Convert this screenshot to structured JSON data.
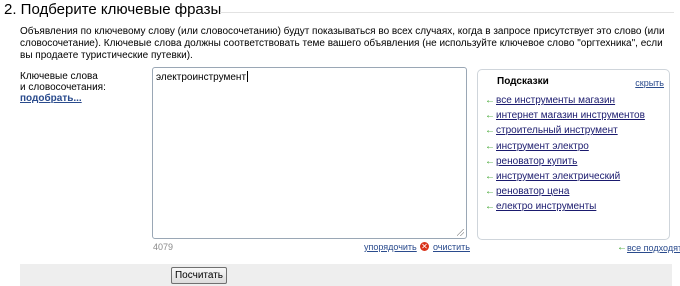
{
  "section": {
    "title": "2. Подберите ключевые фразы",
    "description": "Объявления по ключевому слову (или словосочетанию) будут показываться во всех случаях, когда в запросе присутствует это слово (или словосочетание). Ключевые слова должны соответствовать теме вашего объявления (не используйте ключевое слово \"оргтехника\", если вы продаете туристические путевки)."
  },
  "keywords": {
    "label_line1": "Ключевые слова",
    "label_line2": "и словосочетания:",
    "pick_link": "подобрать...",
    "value": "электроинструмент",
    "counter": "4079",
    "sort_link": "упорядочить",
    "clear_link": "очистить"
  },
  "hints": {
    "title": "Подсказки",
    "hide_link": "скрыть",
    "items": [
      "все инструменты магазин",
      "интернет магазин инструментов",
      "строительный инструмент",
      "инструмент электро",
      "реноватор купить",
      "инструмент электрический",
      "реноватор цена",
      "електро инструменты"
    ],
    "all_fit_link": "все подходят"
  },
  "footer": {
    "calculate_button": "Посчитать"
  },
  "icons": {
    "hint_arrow": "arrow-left-icon",
    "clear": "clear-icon"
  },
  "colors": {
    "link": "#2a4b8d",
    "hint_link": "#1a1a6e",
    "arrow": "#3aa329",
    "clear_icon": "#d9331a",
    "footer_bg": "#eeeeee"
  }
}
